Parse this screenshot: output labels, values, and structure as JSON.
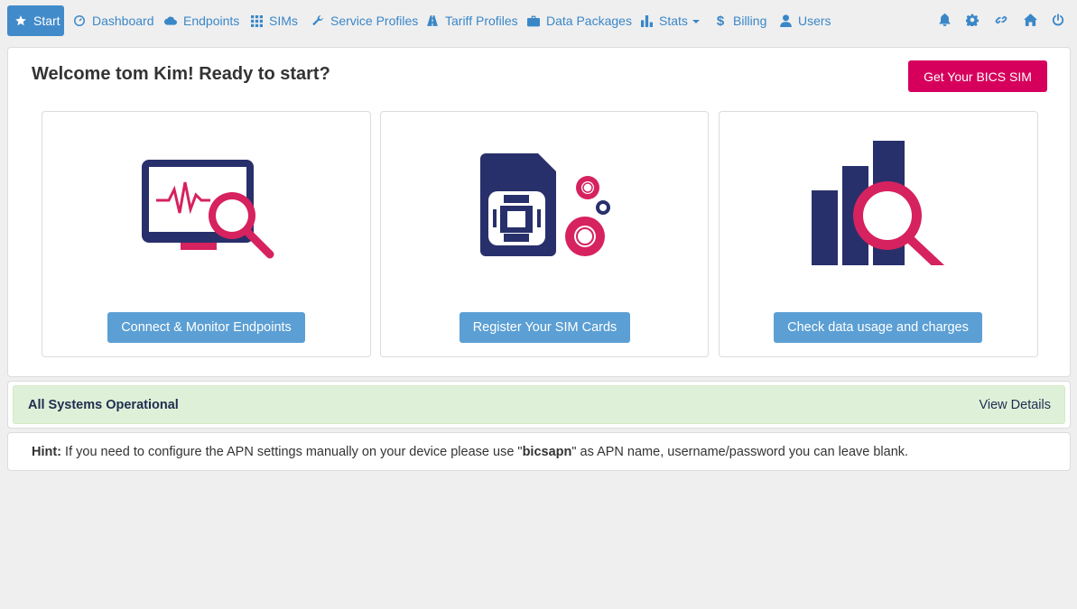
{
  "nav": {
    "items": [
      {
        "label": "Start",
        "icon": "star-icon"
      },
      {
        "label": "Dashboard",
        "icon": "dashboard-icon"
      },
      {
        "label": "Endpoints",
        "icon": "cloud-icon"
      },
      {
        "label": "SIMs",
        "icon": "grid-icon"
      },
      {
        "label": "Service Profiles",
        "icon": "wrench-icon"
      },
      {
        "label": "Tariff Profiles",
        "icon": "road-icon"
      },
      {
        "label": "Data Packages",
        "icon": "briefcase-icon"
      },
      {
        "label": "Stats",
        "icon": "bar-chart-icon"
      },
      {
        "label": "Billing",
        "icon": "dollar-icon"
      },
      {
        "label": "Users",
        "icon": "user-icon"
      }
    ],
    "right_icons": [
      "bell-icon",
      "gear-icon",
      "link-icon",
      "home-icon",
      "power-icon"
    ],
    "accent": "#3a87c8",
    "active_bg": "#428bca"
  },
  "welcome": {
    "title": "Welcome tom Kim! Ready to start?",
    "cta_label": "Get Your BICS SIM",
    "cta_color": "#d6005c"
  },
  "cards": [
    {
      "button": "Connect & Monitor Endpoints",
      "illustration": "monitor-search-icon"
    },
    {
      "button": "Register Your SIM Cards",
      "illustration": "sim-gears-icon"
    },
    {
      "button": "Check data usage and charges",
      "illustration": "chart-search-icon"
    }
  ],
  "status": {
    "text": "All Systems Operational",
    "link": "View Details",
    "bg": "#def0d8"
  },
  "hint": {
    "label": "Hint:",
    "text_before": " If you need to configure the APN settings manually on your device please use \"",
    "apn": "bicsapn",
    "text_after": "\" as APN name, username/password you can leave blank."
  },
  "colors": {
    "navy": "#28306b",
    "magenta": "#d6225e",
    "button_blue": "#5b9fd4"
  }
}
